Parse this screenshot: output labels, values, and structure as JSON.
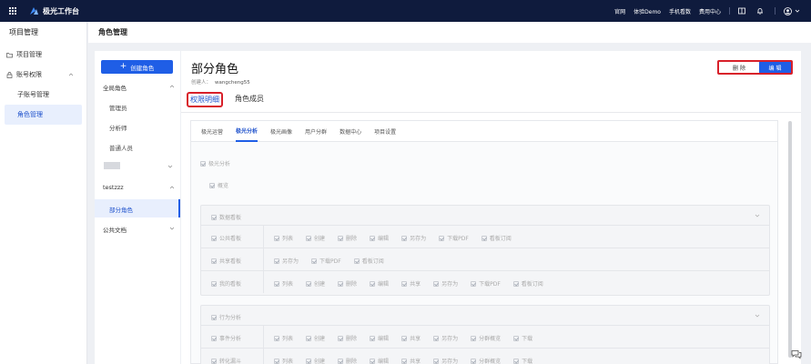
{
  "topbar": {
    "brand": "极光工作台",
    "links": [
      "官网",
      "体验Demo",
      "手机看数",
      "费用中心"
    ]
  },
  "header": {
    "left_title": "项目管理",
    "page_title": "角色管理"
  },
  "sidebar": {
    "items": [
      {
        "label": "项目管理",
        "icon": "folder-icon"
      },
      {
        "label": "账号权限",
        "icon": "lock-icon"
      }
    ],
    "sub_items": [
      {
        "label": "子账号管理"
      },
      {
        "label": "角色管理",
        "active": true
      }
    ]
  },
  "roles": {
    "create_label": "创建角色",
    "groups": [
      {
        "label": "全局角色",
        "items": [
          "管理员",
          "分析师",
          "普通人员"
        ]
      },
      {
        "label": "testzzz",
        "items": [
          "部分角色"
        ]
      },
      {
        "label": "公共文档",
        "items": []
      }
    ]
  },
  "role": {
    "title": "部分角色",
    "creator_label": "创建人：",
    "creator_value": "wangcheng55",
    "delete_label": "删 除",
    "edit_label": "编 辑"
  },
  "tabs": [
    "权限明细",
    "角色成员"
  ],
  "subtabs": [
    "极光运营",
    "极光分析",
    "极光画像",
    "用户分群",
    "数据中心",
    "项目设置"
  ],
  "permissions": {
    "root": "极光分析",
    "overview": "概览",
    "sections": [
      {
        "title": "数据看板",
        "rows": [
          {
            "label": "公共看板",
            "options": [
              "列表",
              "创建",
              "删除",
              "编辑",
              "另存为",
              "下载PDF",
              "看板订阅"
            ]
          },
          {
            "label": "共享看板",
            "options": [
              "另存为",
              "下载PDF",
              "看板订阅"
            ]
          },
          {
            "label": "我的看板",
            "options": [
              "列表",
              "创建",
              "删除",
              "编辑",
              "共享",
              "另存为",
              "下载PDF",
              "看板订阅"
            ]
          }
        ]
      },
      {
        "title": "行为分析",
        "rows": [
          {
            "label": "事件分析",
            "options": [
              "列表",
              "创建",
              "删除",
              "编辑",
              "共享",
              "另存为",
              "分群概览",
              "下载"
            ]
          },
          {
            "label": "转化漏斗",
            "options": [
              "列表",
              "创建",
              "删除",
              "编辑",
              "共享",
              "另存为",
              "分群概览",
              "下载"
            ]
          }
        ]
      }
    ]
  },
  "colors": {
    "topbar_bg": "#0f1b3d",
    "accent": "#1f5ee6",
    "highlight_border": "#d8202a"
  }
}
